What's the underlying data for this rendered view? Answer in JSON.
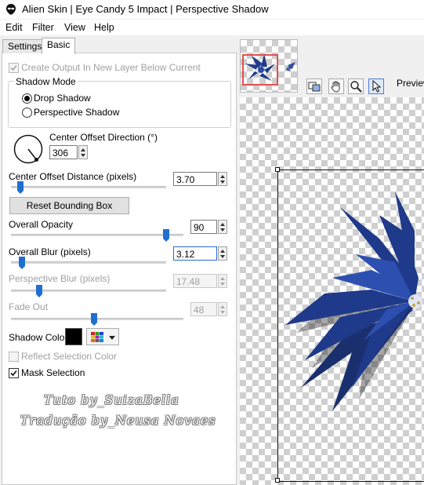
{
  "window": {
    "title": "Alien Skin | Eye Candy 5 Impact | Perspective Shadow"
  },
  "menu": [
    "Edit",
    "Filter",
    "View",
    "Help"
  ],
  "tabs": [
    "Settings",
    "Basic"
  ],
  "basic": {
    "create_layer": {
      "label": "Create Output In New Layer Below Current",
      "checked": true,
      "enabled": false
    },
    "shadow_mode": {
      "legend": "Shadow Mode",
      "options": [
        "Drop Shadow",
        "Perspective Shadow"
      ],
      "selected": "Drop Shadow"
    },
    "direction": {
      "label": "Center Offset Direction (°)",
      "value": "306"
    },
    "distance": {
      "label": "Center Offset Distance (pixels)",
      "value": "3.70",
      "slider_fraction": 0.06
    },
    "reset_label": "Reset Bounding Box",
    "opacity": {
      "label": "Overall Opacity",
      "value": "90",
      "slider_fraction": 0.9
    },
    "blur": {
      "label": "Overall Blur (pixels)",
      "value": "3.12",
      "slider_fraction": 0.07
    },
    "persp_blur": {
      "label": "Perspective Blur (pixels)",
      "value": "17.48",
      "slider_fraction": 0.18,
      "enabled": false
    },
    "fade_out": {
      "label": "Fade Out",
      "value": "48",
      "slider_fraction": 0.48,
      "enabled": false
    },
    "shadow_color": {
      "label": "Shadow Color",
      "color": "#000000"
    },
    "reflect": {
      "label": "Reflect Selection Color",
      "checked": false,
      "enabled": false
    },
    "mask": {
      "label": "Mask Selection",
      "checked": true
    }
  },
  "watermark": {
    "line1": "Tuto by_SuizaBella",
    "line2": "Tradução by_Neusa Novaes"
  },
  "preview": {
    "label": "Preview",
    "tools": [
      "preview-toggle-icon",
      "hand-icon",
      "zoom-icon",
      "arrow-pointer-icon"
    ]
  },
  "colors": {
    "flower": "#1f3a8a",
    "accent": "#1e6fd0",
    "nav_box": "#e05050"
  }
}
